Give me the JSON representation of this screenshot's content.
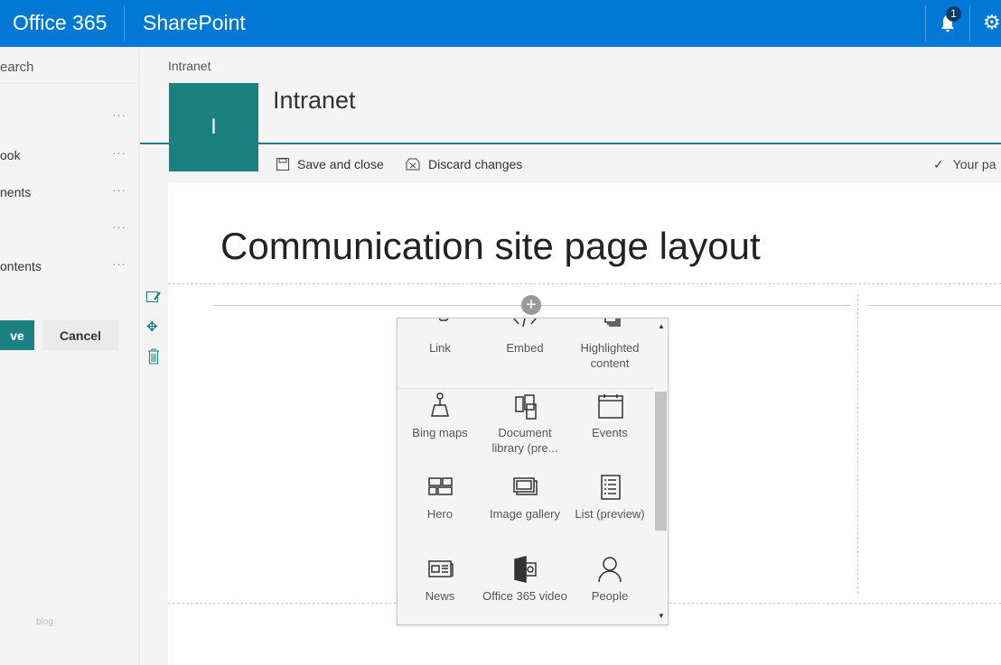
{
  "header": {
    "app": "Office 365",
    "product": "SharePoint",
    "notification_count": "1"
  },
  "nav": {
    "search": "earch",
    "items": [
      "",
      "ook",
      "nents",
      "",
      "ontents"
    ],
    "save": "ve",
    "cancel": "Cancel",
    "footer": "blog"
  },
  "site": {
    "breadcrumb": "Intranet",
    "logo_letter": "I",
    "title": "Intranet"
  },
  "commandbar": {
    "save_close": "Save and close",
    "discard": "Discard changes",
    "status": "Your pa"
  },
  "page": {
    "title": "Communication site page layout"
  },
  "toolbox": {
    "tiles": [
      {
        "label": "Link",
        "icon": "link-icon"
      },
      {
        "label": "Embed",
        "icon": "embed-icon"
      },
      {
        "label": "Highlighted content",
        "icon": "highlighted-content-icon"
      },
      {
        "label": "Bing maps",
        "icon": "map-pin-icon"
      },
      {
        "label": "Document library (pre...",
        "icon": "document-library-icon"
      },
      {
        "label": "Events",
        "icon": "calendar-icon"
      },
      {
        "label": "Hero",
        "icon": "hero-icon"
      },
      {
        "label": "Image gallery",
        "icon": "image-gallery-icon"
      },
      {
        "label": "List (preview)",
        "icon": "list-icon"
      },
      {
        "label": "News",
        "icon": "news-icon"
      },
      {
        "label": "Office 365 video",
        "icon": "video-icon"
      },
      {
        "label": "People",
        "icon": "person-icon"
      }
    ]
  },
  "colors": {
    "brand": "#0078d4",
    "teal": "#1b8080"
  }
}
